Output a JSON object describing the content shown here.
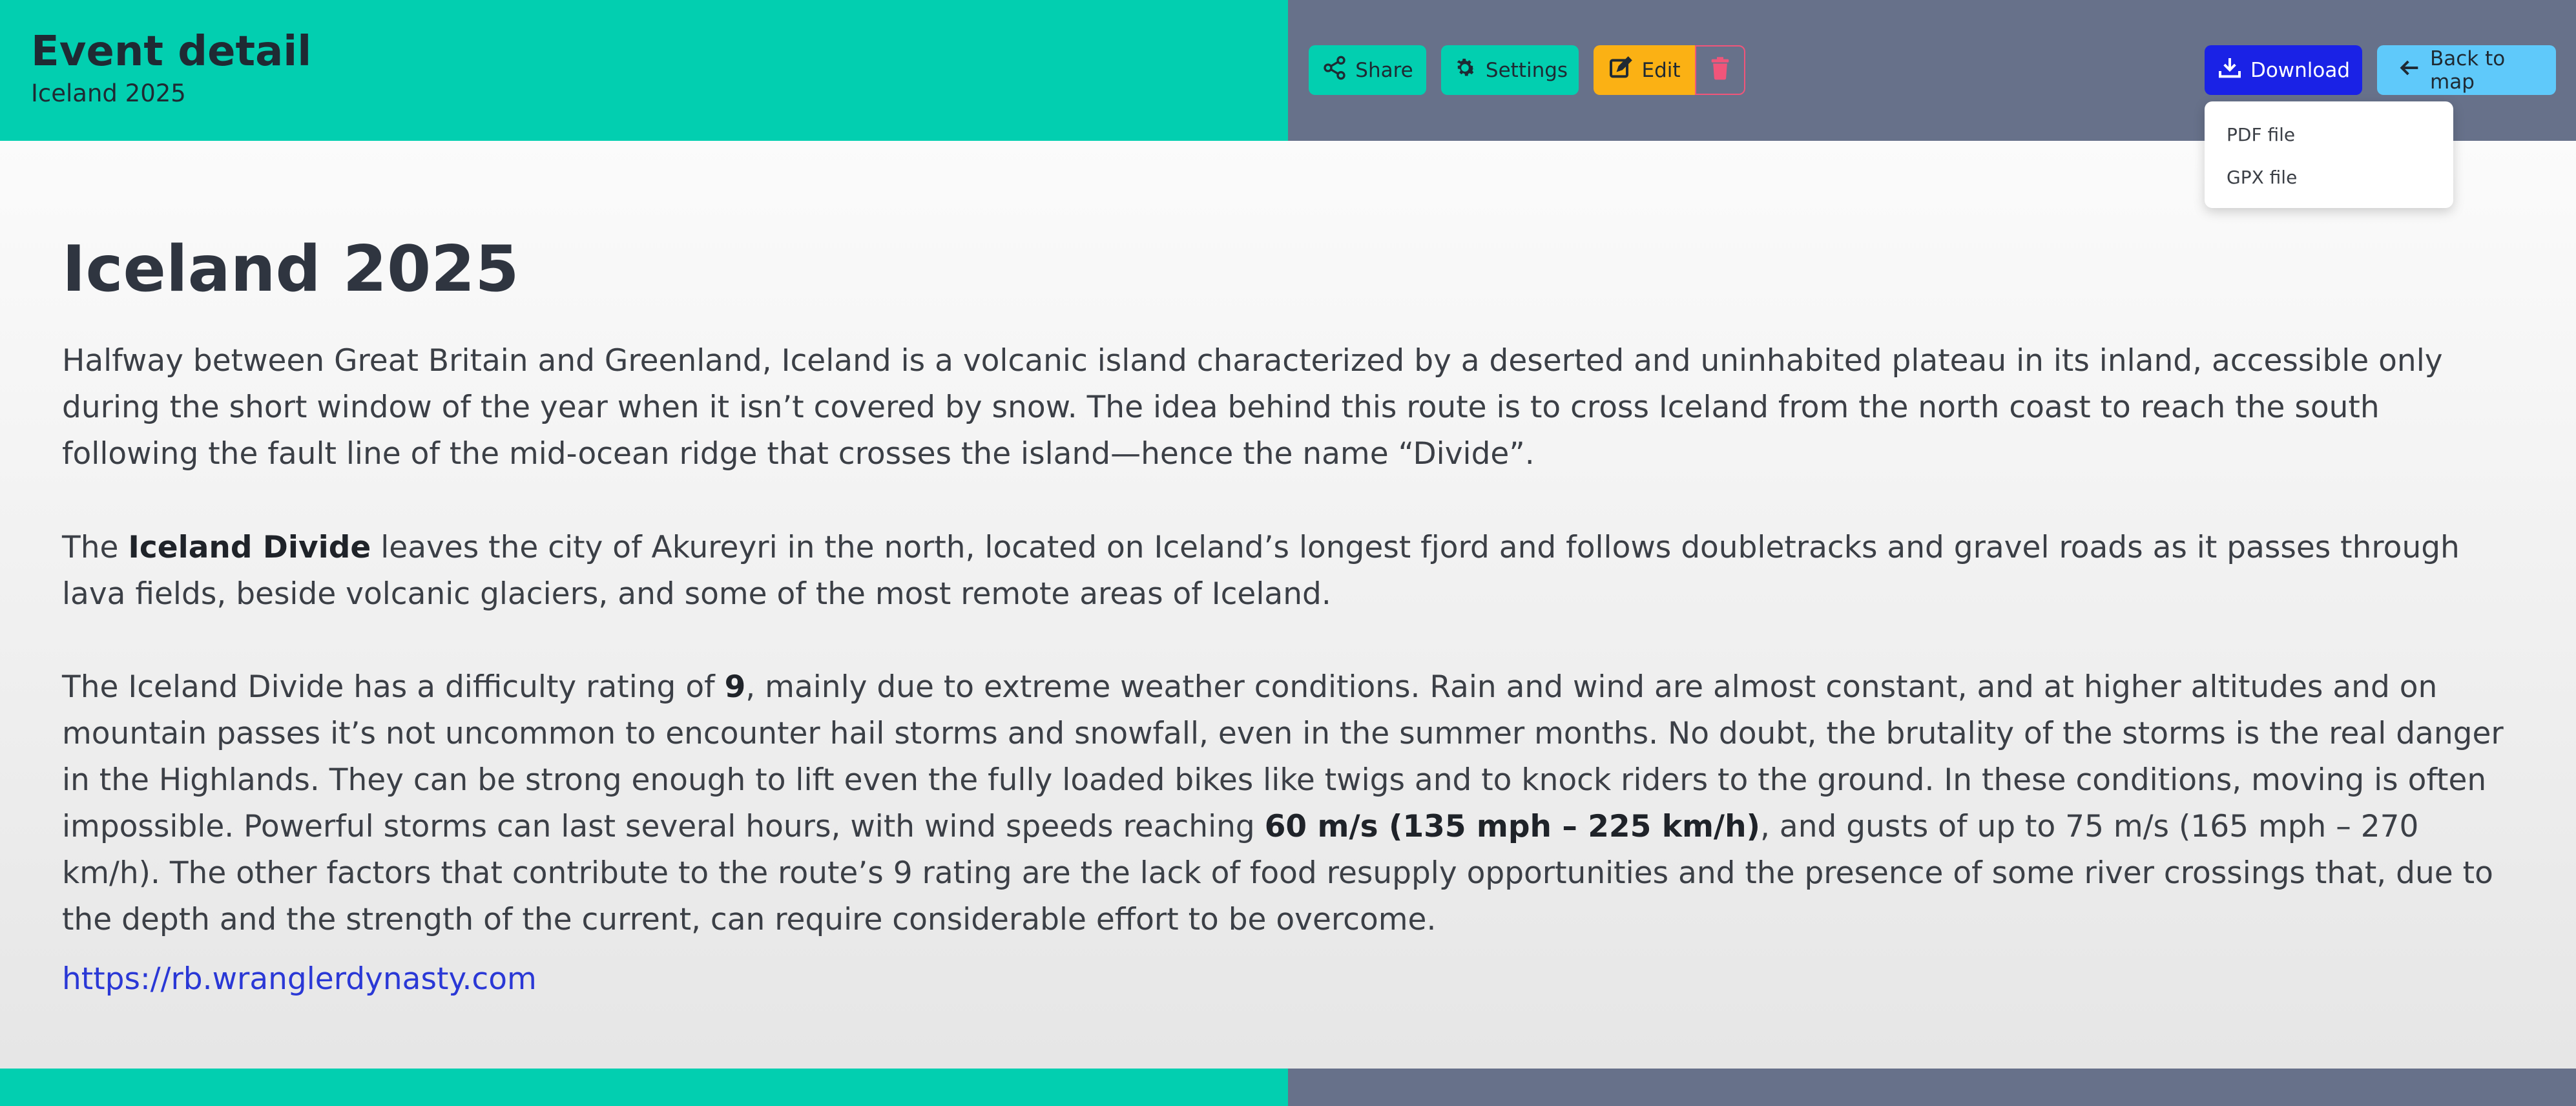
{
  "header": {
    "title": "Event detail",
    "subtitle": "Iceland 2025"
  },
  "toolbar": {
    "share": "Share",
    "settings": "Settings",
    "edit": "Edit",
    "download": "Download",
    "back": "Back to map"
  },
  "download_menu": {
    "items": [
      "PDF file",
      "GPX file"
    ]
  },
  "colors": {
    "accent": "#02cfb0",
    "slate": "#67718a",
    "edit": "#fbb114",
    "delete": "#f1557a",
    "download": "#1a22e6",
    "back": "#5fc9fa",
    "link": "#2a38d6"
  },
  "icons": {
    "share": "share-icon",
    "settings": "gear-icon",
    "edit": "edit-icon",
    "delete": "trash-icon",
    "download": "download-icon",
    "back": "arrow-left-icon"
  },
  "article": {
    "title": "Iceland 2025",
    "p1": "Halfway between Great Britain and Greenland, Iceland is a volcanic island characterized by a deserted and uninhabited plateau in its inland, accessible only during the short window of the year when it isn’t covered by snow. The idea behind this route is to cross Iceland from the north coast to reach the south following the fault line of the mid-ocean ridge that crosses the island—hence the name “Divide”.",
    "p2": {
      "pre": "The ",
      "bold": "Iceland Divide",
      "post": " leaves the city of Akureyri in the north, located on Iceland’s longest fjord and follows doubletracks and gravel roads as it passes through lava fields, beside volcanic glaciers, and some of the most remote areas of Iceland."
    },
    "p3": {
      "pre": "The Iceland Divide has a difficulty rating of ",
      "rating": "9",
      "mid": ", mainly due to extreme weather conditions. Rain and wind are almost constant, and at higher altitudes and on mountain passes it’s not uncommon to encounter hail storms and snowfall, even in the summer months. No doubt, the brutality of the storms is the real danger in the Highlands. They can be strong enough to lift even the fully loaded bikes like twigs and to knock riders to the ground. In these conditions, moving is often impossible. Powerful storms can last several hours, with wind speeds reaching ",
      "speed": "60 m/s (135 mph – 225 km/h)",
      "post": ", and gusts of up to 75 m/s (165 mph – 270 km/h). The other factors that contribute to the route’s 9 rating are the lack of food resupply opportunities and the presence of some river crossings that, due to the depth and the strength of the current, can require considerable effort to be overcome."
    },
    "link": "https://rb.wranglerdynasty.com"
  }
}
